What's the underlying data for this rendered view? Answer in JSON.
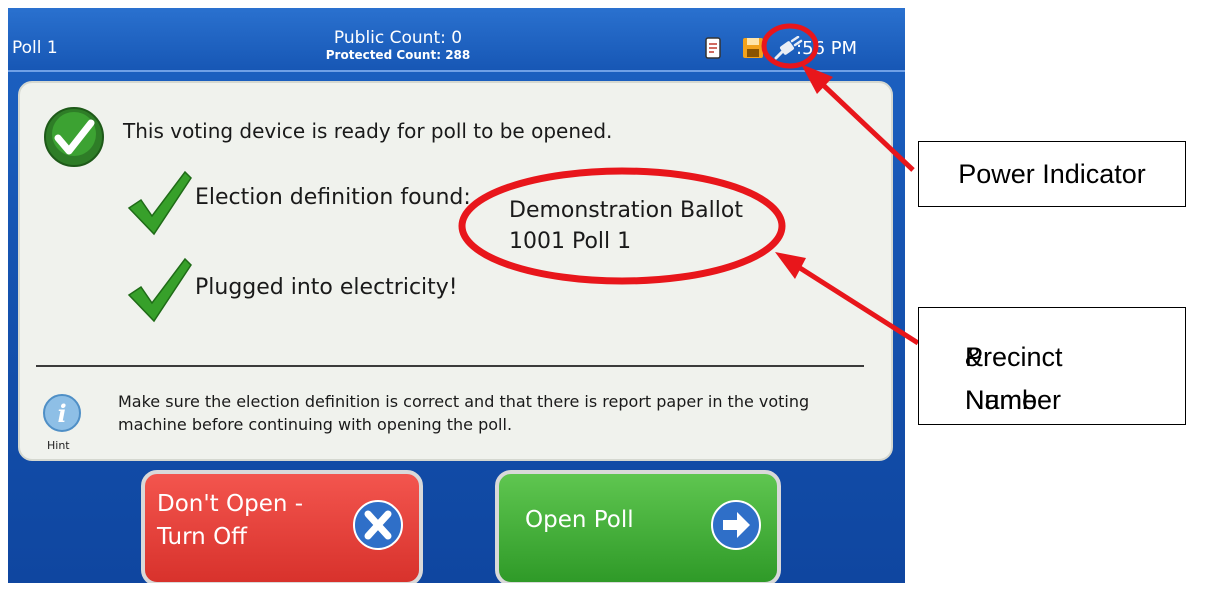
{
  "header": {
    "poll_name": "Poll 1",
    "public_count": "Public Count: 0",
    "protected_count": "Protected Count: 288",
    "time": ":56 PM",
    "icons": [
      "document-icon",
      "save-icon",
      "power-plug-icon"
    ]
  },
  "main": {
    "status": "This voting device is ready for poll to be opened.",
    "checks": [
      {
        "label": "Election definition found:",
        "icon": "checkmark-icon"
      },
      {
        "label": "Plugged into electricity!",
        "icon": "checkmark-icon"
      }
    ],
    "ballot_name_line1": "Demonstration Ballot",
    "ballot_name_line2": "1001 Poll 1",
    "hint": "Make sure the election definition is correct and that there is report paper in the voting machine before continuing with opening the poll.",
    "hint_label": "Hint"
  },
  "buttons": {
    "dont_open_line1": "Don't Open -",
    "dont_open_line2": "Turn Off",
    "open_poll": "Open Poll"
  },
  "annotations": {
    "power_indicator": "Power Indicator",
    "precinct_line1": "Precinct Name",
    "precinct_line2": "& Number"
  },
  "colors": {
    "screen_blue": "#1553b0",
    "check_green": "#3aa02c",
    "turn_off_red": "#d8322c",
    "open_poll_green": "#2f9a28",
    "annotation_red": "#e8161b"
  }
}
